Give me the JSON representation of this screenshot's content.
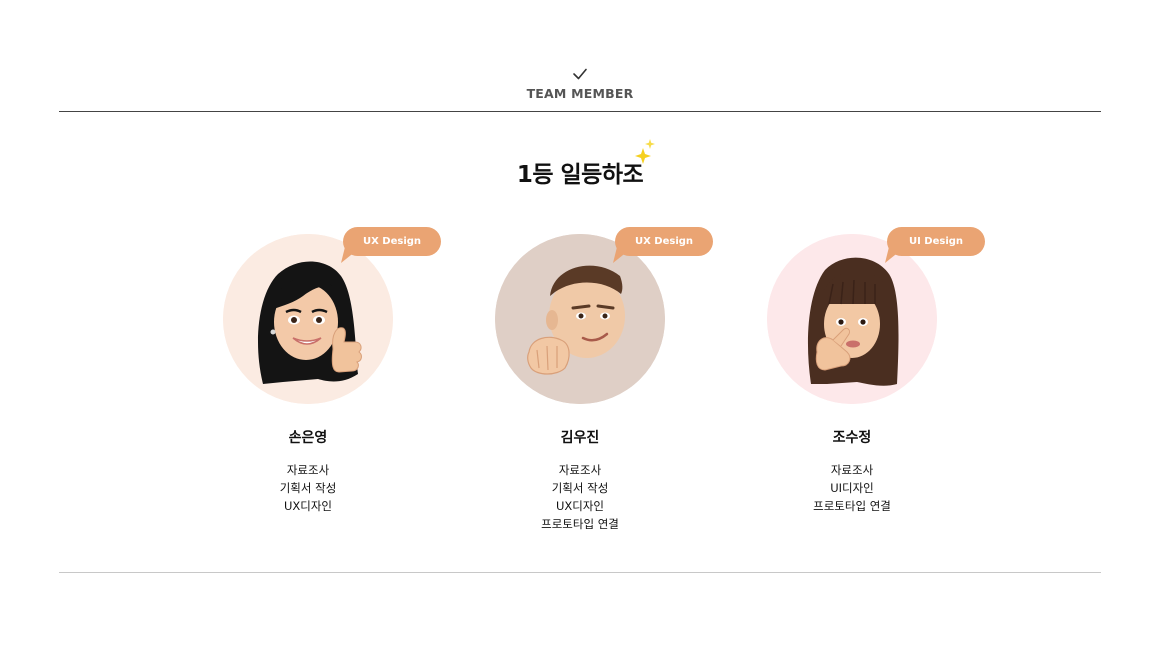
{
  "section": {
    "icon": "checkmark-icon",
    "label": "TEAM MEMBER"
  },
  "team": {
    "name": "1등 일등하조",
    "decoration_icon": "sparkle-icon"
  },
  "members": [
    {
      "name": "손은영",
      "tag": "UX Design",
      "avatar": "memoji-woman-long-black-hair-thumbs-up",
      "circle_color": "#fbebe2",
      "roles": [
        "자료조사",
        "기획서 작성",
        "UX디자인"
      ]
    },
    {
      "name": "김우진",
      "tag": "UX Design",
      "avatar": "memoji-man-short-hair-fist-bump",
      "circle_color": "#dfcfc6",
      "roles": [
        "자료조사",
        "기획서 작성",
        "UX디자인",
        "프로토타입 연결"
      ]
    },
    {
      "name": "조수정",
      "tag": "UI Design",
      "avatar": "memoji-woman-bangs-thinking",
      "circle_color": "#fde8ea",
      "roles": [
        "자료조사",
        "UI디자인",
        "프로토타입 연결"
      ]
    }
  ],
  "colors": {
    "tag_background": "#eaa473",
    "sparkle": "#f5d020"
  }
}
